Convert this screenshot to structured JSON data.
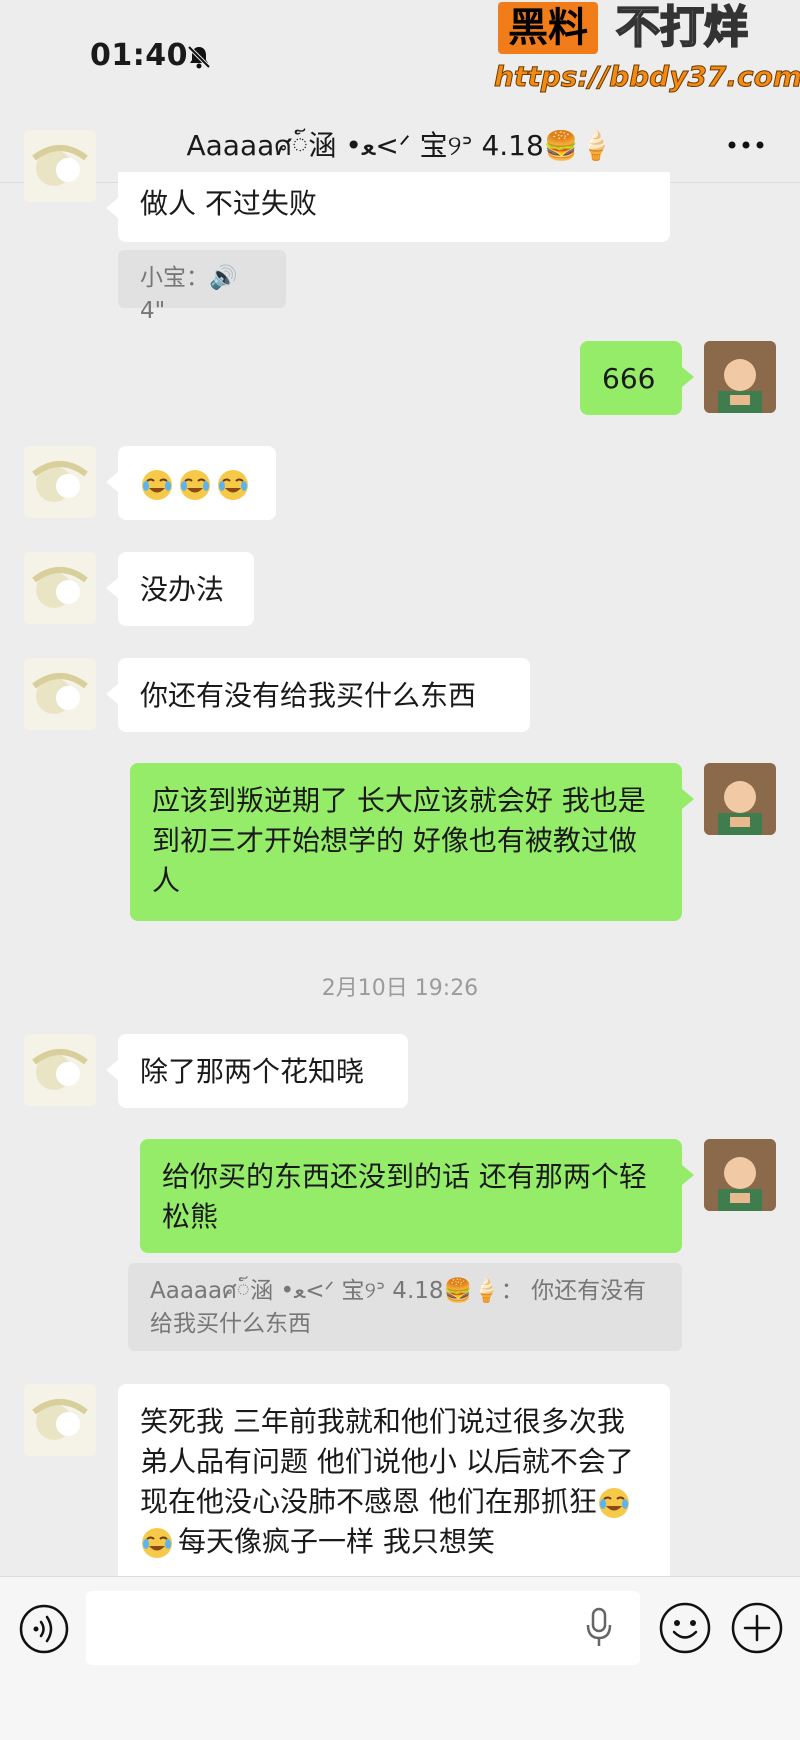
{
  "status_bar": {
    "time": "01:40"
  },
  "watermark": {
    "box_text": "黑料",
    "text": "不打烊",
    "url": "https://bbdy37.com"
  },
  "header": {
    "title": "Aaaaaศ៍涵 •ﻌ<ᐟ 宝୨ᐣ 4.18🍔🍦"
  },
  "messages": [
    {
      "side": "left",
      "text": "做人 不过失败"
    },
    {
      "quote": "小宝：🔊 4\""
    },
    {
      "side": "right",
      "text": "666"
    },
    {
      "side": "left",
      "emojis": [
        "😭",
        "😭",
        "😭"
      ]
    },
    {
      "side": "left",
      "text": "没办法"
    },
    {
      "side": "left",
      "text": "你还有没有给我买什么东西"
    },
    {
      "side": "right",
      "text": "应该到叛逆期了 长大应该就会好 我也是到初三才开始想学的 好像也有被教过做人"
    },
    {
      "timestamp": "2月10日 19:26"
    },
    {
      "side": "left",
      "text": "除了那两个花知晓"
    },
    {
      "side": "right",
      "text": "给你买的东西还没到的话 还有那两个轻松熊"
    },
    {
      "quote": "Aaaaaศ៍涵 •ﻌ<ᐟ 宝୨ᐣ 4.18🍔🍦： 你还有没有给我买什么东西"
    },
    {
      "side": "left",
      "text_a": "笑死我 三年前我就和他们说过很多次我弟人品有问题 他们说他小 以后就不会了 现在他没心没肺不感恩 他们在那抓狂",
      "text_b": "每天像疯子一样 我只想笑"
    }
  ],
  "input_bar": {
    "placeholder": ""
  },
  "colors": {
    "background": "#ededed",
    "green_bubble": "#95ec69",
    "white_bubble": "#ffffff",
    "watermark_orange": "#f07c1a"
  }
}
